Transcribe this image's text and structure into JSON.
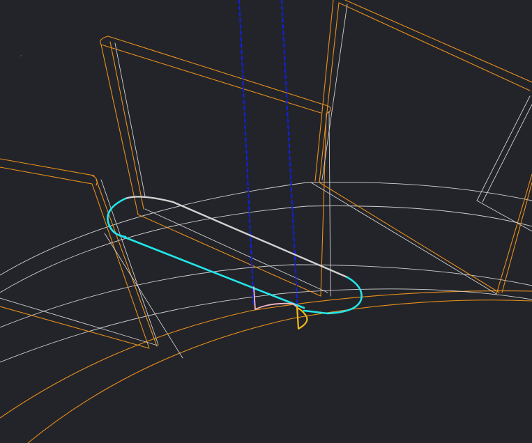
{
  "viewport": {
    "description_label": "",
    "colors": {
      "background": "#232429",
      "wireframe_orange": "#e8901c",
      "wireframe_white": "#d0d0d0",
      "tool_profile_cyan": "#22e6ea",
      "tool_profile_gray": "#d2d2d2",
      "contact_pink": "#f4b8c8",
      "contact_yellow": "#f0b81a",
      "tool_axis_blue": "#1020e8"
    },
    "icons": {
      "tool_axis": "dashed-line-icon"
    }
  }
}
